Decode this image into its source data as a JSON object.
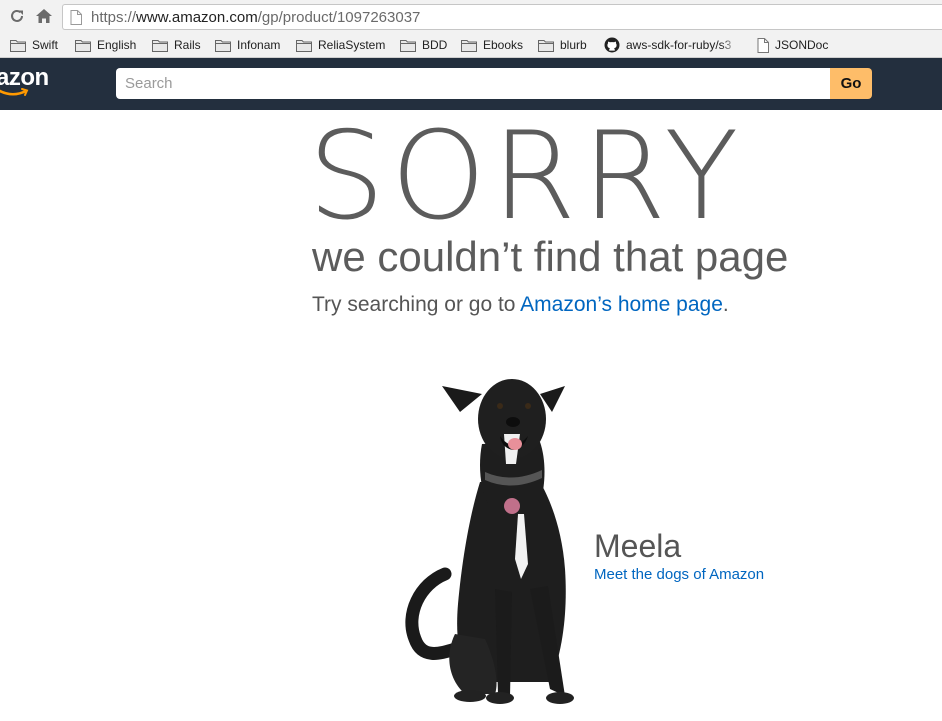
{
  "browser": {
    "url_scheme": "https://",
    "url_host": "www.amazon.com",
    "url_path": "/gp/product/1097263037",
    "bookmarks": [
      {
        "label": "Swift",
        "icon": "folder-icon"
      },
      {
        "label": "English",
        "icon": "folder-icon"
      },
      {
        "label": "Rails",
        "icon": "folder-icon"
      },
      {
        "label": "Infonam",
        "icon": "folder-icon"
      },
      {
        "label": "ReliaSystem",
        "icon": "folder-icon"
      },
      {
        "label": "BDD",
        "icon": "folder-icon"
      },
      {
        "label": "Ebooks",
        "icon": "folder-icon"
      },
      {
        "label": "blurb",
        "icon": "folder-icon"
      },
      {
        "label": "aws-sdk-for-ruby/s3",
        "icon": "github-icon"
      },
      {
        "label": "JSONDoc",
        "icon": "page-icon"
      }
    ]
  },
  "header": {
    "logo_text": "azon",
    "search_placeholder": "Search",
    "go_label": "Go",
    "colors": {
      "background": "#232f3e",
      "go_button": "#febd69"
    }
  },
  "error_page": {
    "headline": "SORRY",
    "subheadline": "we couldn’t find that page",
    "try_text": "Try searching or go to ",
    "home_link": "Amazon’s home page",
    "try_suffix": ".",
    "dog_name": "Meela",
    "dog_link": "Meet the dogs of Amazon",
    "link_color": "#0066c0"
  }
}
